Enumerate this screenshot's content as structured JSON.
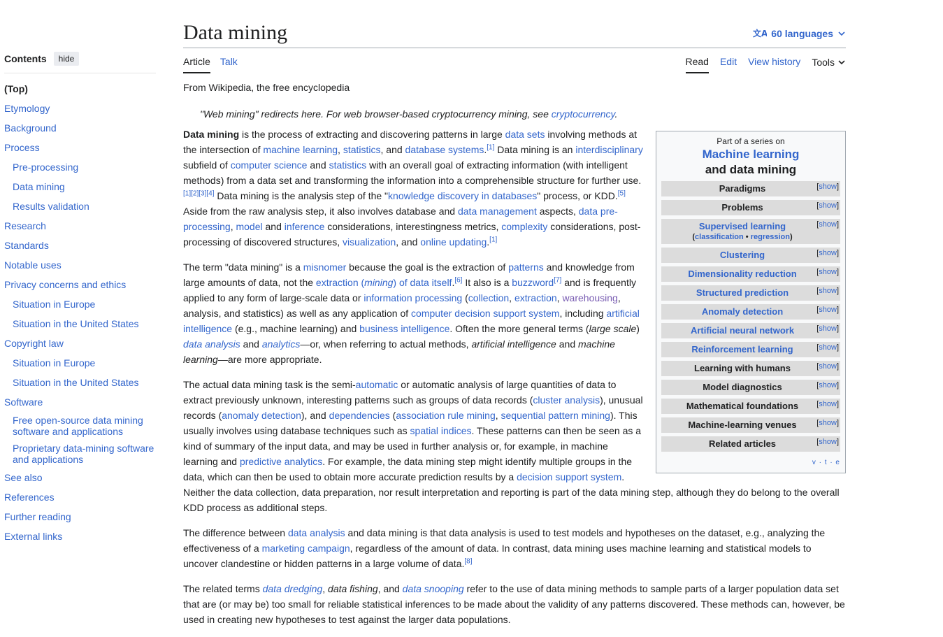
{
  "toc": {
    "title": "Contents",
    "hide_label": "hide",
    "top_label": "(Top)",
    "items": {
      "etymology": "Etymology",
      "background": "Background",
      "process": "Process",
      "preprocessing": "Pre-processing",
      "data_mining": "Data mining",
      "results_validation": "Results validation",
      "research": "Research",
      "standards": "Standards",
      "notable_uses": "Notable uses",
      "privacy": "Privacy concerns and ethics",
      "privacy_europe": "Situation in Europe",
      "privacy_us": "Situation in the United States",
      "copyright": "Copyright law",
      "copyright_europe": "Situation in Europe",
      "copyright_us": "Situation in the United States",
      "software": "Software",
      "free_software": "Free open-source data mining software and applications",
      "proprietary_software": "Proprietary data-mining software and applications",
      "see_also": "See also",
      "references": "References",
      "further_reading": "Further reading",
      "external_links": "External links"
    }
  },
  "header": {
    "title": "Data mining",
    "languages": "60 languages",
    "tab_article": "Article",
    "tab_talk": "Talk",
    "tab_read": "Read",
    "tab_edit": "Edit",
    "tab_history": "View history",
    "tab_tools": "Tools"
  },
  "from": "From Wikipedia, the free encyclopedia",
  "hatnote": {
    "text": "\"Web mining\" redirects here. For web browser-based cryptocurrency mining, see ",
    "link": "cryptocurrency",
    "end": "."
  },
  "sidebar": {
    "pre": "Part of a series on",
    "title_link": "Machine learning",
    "title_rest": "and data mining",
    "show": "show",
    "rows": {
      "paradigms": "Paradigms",
      "problems": "Problems",
      "supervised": "Supervised learning",
      "classification": "classification",
      "regression": "regression",
      "clustering": "Clustering",
      "dimensionality": "Dimensionality reduction",
      "structured": "Structured prediction",
      "anomaly": "Anomaly detection",
      "ann": "Artificial neural network",
      "reinforcement": "Reinforcement learning",
      "humans": "Learning with humans",
      "diagnostics": "Model diagnostics",
      "math": "Mathematical foundations",
      "venues": "Machine-learning venues",
      "related": "Related articles"
    },
    "vte": "v · t · e"
  },
  "accent_color": "#3366cc",
  "visited_color": "#795cb2"
}
